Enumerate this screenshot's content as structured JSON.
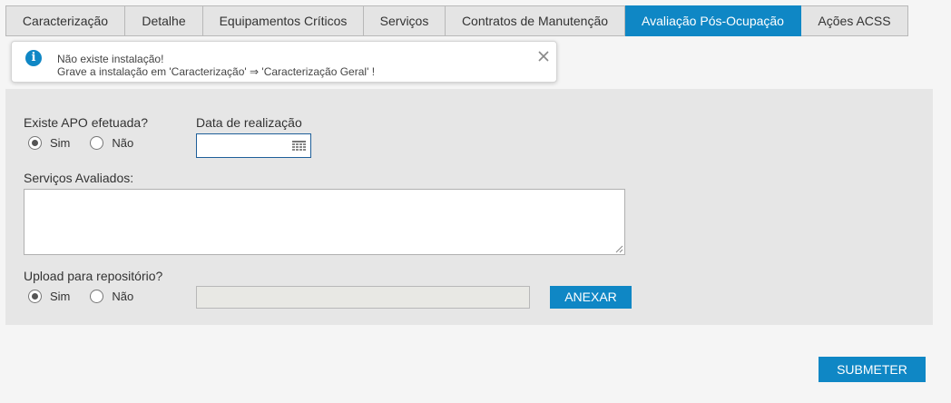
{
  "tabs": [
    {
      "label": "Caracterização",
      "active": false
    },
    {
      "label": "Detalhe",
      "active": false
    },
    {
      "label": "Equipamentos Críticos",
      "active": false
    },
    {
      "label": "Serviços",
      "active": false
    },
    {
      "label": "Contratos de Manutenção",
      "active": false
    },
    {
      "label": "Avaliação Pós-Ocupação",
      "active": true
    },
    {
      "label": "Ações ACSS",
      "active": false
    }
  ],
  "alert": {
    "line1": "Não existe instalação!",
    "line2": "Grave a instalação em 'Caracterização' ⇒ 'Caracterização Geral' !",
    "icon": "info-icon"
  },
  "form": {
    "apo_label": "Existe APO efetuada?",
    "apo_options": [
      {
        "label": "Sim",
        "checked": true
      },
      {
        "label": "Não",
        "checked": false
      }
    ],
    "date_label": "Data de realização",
    "date_value": "",
    "services_label": "Serviços Avaliados:",
    "services_value": "",
    "upload_label": "Upload para repositório?",
    "upload_options": [
      {
        "label": "Sim",
        "checked": true
      },
      {
        "label": "Não",
        "checked": false
      }
    ],
    "file_value": "",
    "attach_button": "ANEXAR"
  },
  "submit_button": "SUBMETER",
  "colors": {
    "accent": "#0f87c5",
    "panel": "#e6e6e6",
    "background": "#f5f5f5"
  }
}
